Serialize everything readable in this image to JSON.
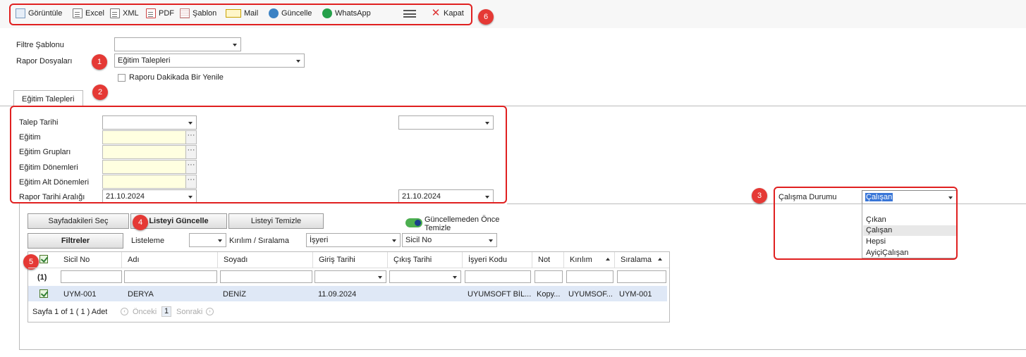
{
  "toolbar": {
    "items": [
      {
        "label": "Görüntüle",
        "icon": "view-icon"
      },
      {
        "label": "Excel",
        "icon": "excel-icon"
      },
      {
        "label": "XML",
        "icon": "xml-icon"
      },
      {
        "label": "PDF",
        "icon": "pdf-icon"
      },
      {
        "label": "Şablon",
        "icon": "template-icon"
      },
      {
        "label": "Mail",
        "icon": "mail-icon"
      },
      {
        "label": "Güncelle",
        "icon": "refresh-icon"
      },
      {
        "label": "WhatsApp",
        "icon": "whatsapp-icon"
      },
      {
        "label": "",
        "icon": "menu-icon"
      },
      {
        "label": "Kapat",
        "icon": "close-icon"
      }
    ]
  },
  "badges": [
    "1",
    "2",
    "3",
    "4",
    "5",
    "6"
  ],
  "top_form": {
    "filter_template_label": "Filtre Şablonu",
    "filter_template_value": "",
    "report_files_label": "Rapor Dosyaları",
    "report_files_value": "Eğitim Talepleri",
    "refresh_checkbox_label": "Raporu Dakikada Bir Yenile",
    "refresh_checked": false
  },
  "tab": {
    "label": "Eğitim Talepleri"
  },
  "filters": {
    "request_date_label": "Talep Tarihi",
    "training_label": "Eğitim",
    "training_groups_label": "Eğitim Grupları",
    "training_periods_label": "Eğitim Dönemleri",
    "training_subperiods_label": "Eğitim Alt Dönemleri",
    "report_date_range_label": "Rapor Tarihi Aralığı",
    "report_date_start": "21.10.2024",
    "report_date_end": "21.10.2024",
    "ellipsis": "···"
  },
  "work_status": {
    "label": "Çalışma Durumu",
    "selected": "Çalışan",
    "options": [
      "",
      "Çıkan",
      "Çalışan",
      "Hepsi",
      "AyiçiÇalışan"
    ]
  },
  "actions": {
    "select_page": "Sayfadakileri Seç",
    "update_list": "Listeyi Güncelle",
    "clear_list": "Listeyi Temizle",
    "clear_before_update": "Güncellemeden Önce Temizle",
    "filters_button": "Filtreler",
    "listing_label": "Listeleme",
    "listing_value": "",
    "grouping_label": "Kırılım / Sıralama",
    "grouping_value": "İşyeri",
    "sort_value": "Sicil No"
  },
  "grid": {
    "columns": [
      "Sicil No",
      "Adı",
      "Soyadı",
      "Giriş Tarihi",
      "Çıkış Tarihi",
      "İşyeri Kodu",
      "Not",
      "Kırılım",
      "Sıralama"
    ],
    "count_label": "(1)",
    "rows": [
      [
        "UYM-001",
        "DERYA",
        "DENİZ",
        "11.09.2024",
        "",
        "UYUMSOFT BİL...",
        "Kopy...",
        "UYUMSOF...",
        "UYM-001"
      ]
    ],
    "pager": {
      "text": "Sayfa 1 of 1 ( 1 ) Adet",
      "prev": "Önceki",
      "page": "1",
      "next": "Sonraki"
    }
  },
  "colors": {
    "accent_red": "#e02020",
    "badge_red": "#e53935",
    "selected_row": "#dfe8f6",
    "toggle_green": "#4caf50"
  }
}
